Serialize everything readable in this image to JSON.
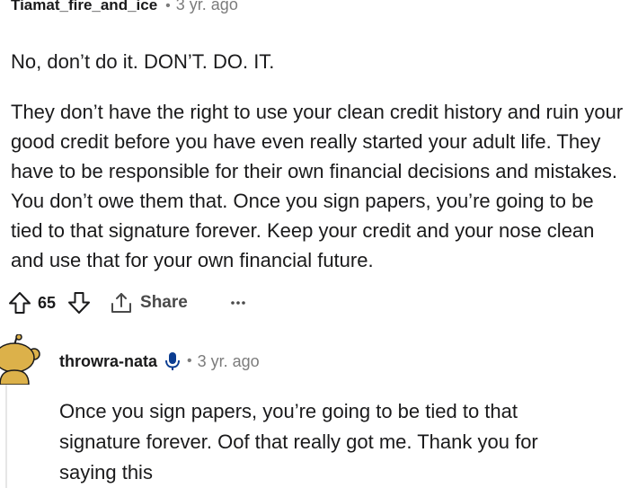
{
  "comment": {
    "author": "Tiamat_fire_and_ice",
    "separator": "•",
    "timestamp": "3 yr. ago",
    "paragraphs": [
      "No, don’t do it. DON’T. DO. IT.",
      "They don’t have the right to use your clean credit history and ruin your good credit before you have even really started your adult life. They have to be responsible for their own financial decisions and mistakes. You don’t owe them that. Once you sign papers, you’re going to be tied to that signature forever. Keep your credit and your nose clean and use that for your own financial future."
    ],
    "actions": {
      "score": "65",
      "share_label": "Share",
      "upvote_icon": "arrow-up-outline-icon",
      "downvote_icon": "arrow-down-outline-icon",
      "share_icon": "share-upload-icon",
      "more_icon": "ellipsis-icon"
    }
  },
  "reply": {
    "author": "throwra-nata",
    "author_icon": "microphone-icon",
    "separator": "•",
    "timestamp": "3 yr. ago",
    "body": "Once you sign papers, you’re going to be tied to that signature forever. Oof that really got me. Thank you for saying this",
    "avatar_icon": "snoo-avatar-icon",
    "avatar_color": "#dcb14a"
  },
  "colors": {
    "text": "#1a1a1b",
    "muted": "#7c7c7c",
    "icon": "#4a4a4a",
    "accent_blue": "#0b3d91"
  }
}
